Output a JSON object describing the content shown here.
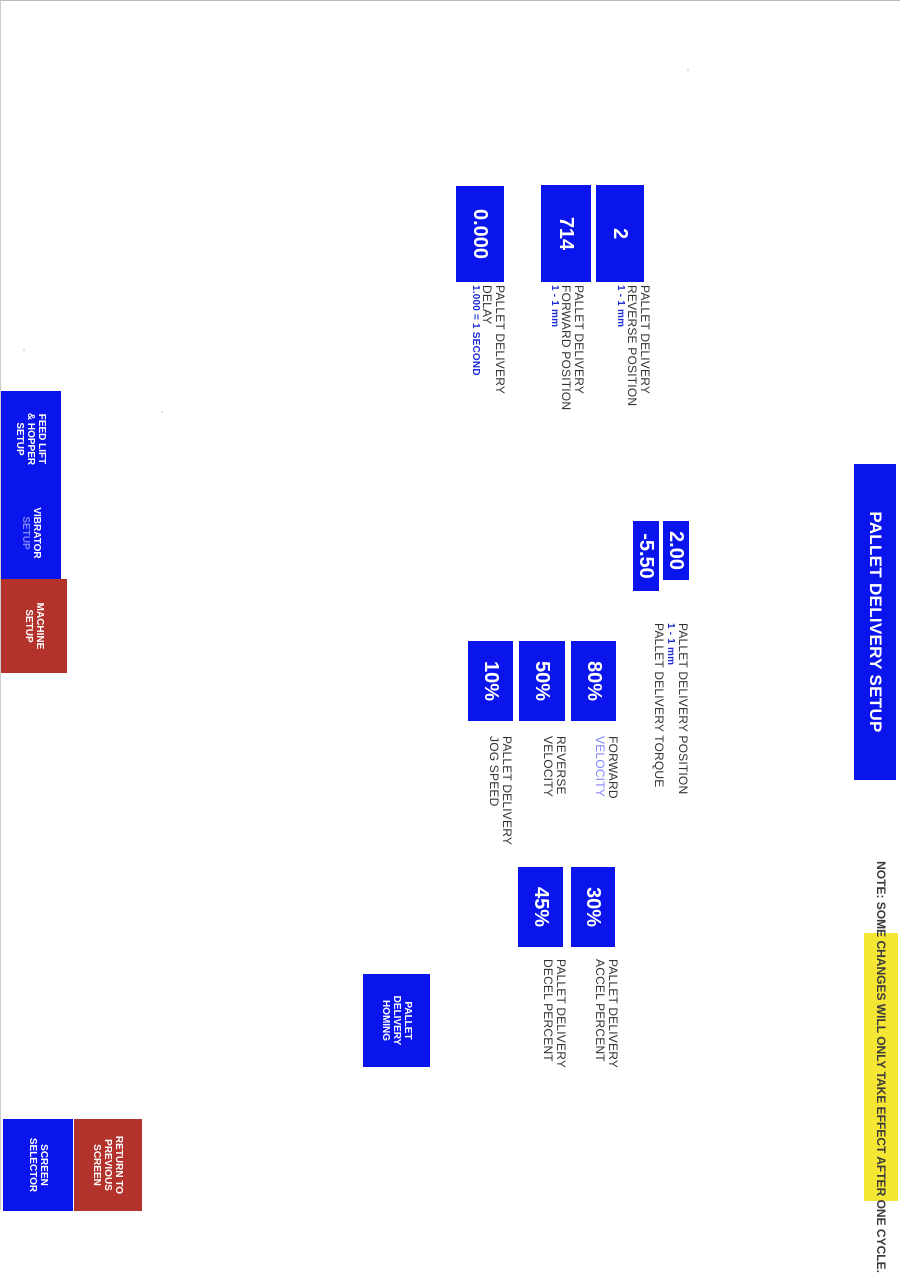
{
  "title": "PALLET DELIVERY SETUP",
  "note": "NOTE: SOME CHANGES WILL ONLY TAKE EFFECT AFTER ONE CYCLE.",
  "position_params": [
    {
      "value": "2",
      "label": [
        "PALLET DELIVERY",
        "REVERSE POSITION"
      ],
      "range": "1 - 1 mm"
    },
    {
      "value": "714",
      "label": [
        "PALLET DELIVERY",
        "FORWARD POSITION"
      ],
      "range": "1 - 1 mm"
    },
    {
      "value": "0.000",
      "label": [
        "PALLET DELIVERY",
        "DELAY"
      ],
      "range": "1.000 = 1 SECOND"
    }
  ],
  "position_torque": {
    "position_value": "2.00",
    "torque_value": "-5.50",
    "label1": "PALLET DELIVERY POSITION",
    "range": "1 - 1 mm",
    "label2": "PALLET DELIVERY TORQUE"
  },
  "velocity_params": [
    {
      "value": "80%",
      "label": [
        "FORWARD",
        "VELOCITY"
      ]
    },
    {
      "value": "50%",
      "label": [
        "REVERSE",
        "VELOCITY"
      ]
    },
    {
      "value": "10%",
      "label": [
        "PALLET DELIVERY",
        "JOG SPEED"
      ]
    }
  ],
  "accel_params": [
    {
      "value": "30%",
      "label": [
        "PALLET DELIVERY",
        "ACCEL PERCENT"
      ]
    },
    {
      "value": "45%",
      "label": [
        "PALLET DELIVERY",
        "DECEL PERCENT"
      ]
    }
  ],
  "homing_button": [
    "PALLET",
    "DELIVERY",
    "HOMING"
  ],
  "nav": {
    "feed_lift": [
      "FEED LIFT",
      "& HOPPER",
      "SETUP"
    ],
    "vibrator": [
      "VIBRATOR",
      "SETUP"
    ],
    "machine": [
      "MACHINE",
      "SETUP"
    ],
    "return": [
      "RETURN TO",
      "PREVIOUS",
      "SCREEN"
    ],
    "screen_selector": [
      "SCREEN",
      "SELECTOR"
    ]
  },
  "colors": {
    "blue": "#0a14ec",
    "red": "#b3332c",
    "yellow": "#f5e634",
    "range_text": "#1b2bd6"
  }
}
